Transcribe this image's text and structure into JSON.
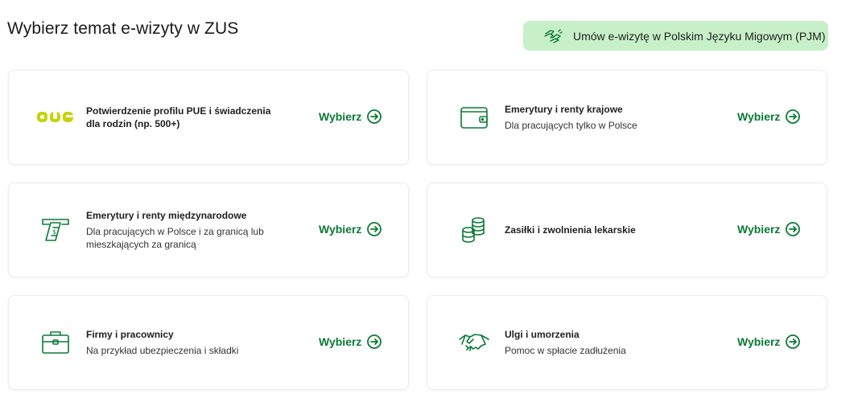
{
  "header": {
    "title": "Wybierz temat e-wizyty w ZUS",
    "pjm_button_label": "Umów e-wizytę w Polskim Języku Migowym (PJM)",
    "pjm_icon": "sign-language-icon"
  },
  "colors": {
    "accent_green": "#0b7a38",
    "pjm_background": "#c8f0c8",
    "pue_logo": "#c5d300"
  },
  "cards": [
    {
      "icon": "pue-logo",
      "title": "Potwierdzenie profilu PUE i świadczenia dla rodzin (np. 500+)",
      "description": "",
      "choose_label": "Wybierz"
    },
    {
      "icon": "wallet-icon",
      "title": "Emerytury i renty krajowe",
      "description": "Dla pracujących tylko w Polsce",
      "choose_label": "Wybierz"
    },
    {
      "icon": "international-money-icon",
      "title": "Emerytury i renty międzynarodowe",
      "description": "Dla pracujących w Polsce i za granicą lub mieszkających za granicą",
      "choose_label": "Wybierz"
    },
    {
      "icon": "coins-icon",
      "title": "Zasiłki i zwolnienia lekarskie",
      "description": "",
      "choose_label": "Wybierz"
    },
    {
      "icon": "briefcase-icon",
      "title": "Firmy i pracownicy",
      "description": "Na przykład ubezpieczenia i składki",
      "choose_label": "Wybierz"
    },
    {
      "icon": "handshake-icon",
      "title": "Ulgi i umorzenia",
      "description": "Pomoc w spłacie zadłużenia",
      "choose_label": "Wybierz"
    }
  ]
}
